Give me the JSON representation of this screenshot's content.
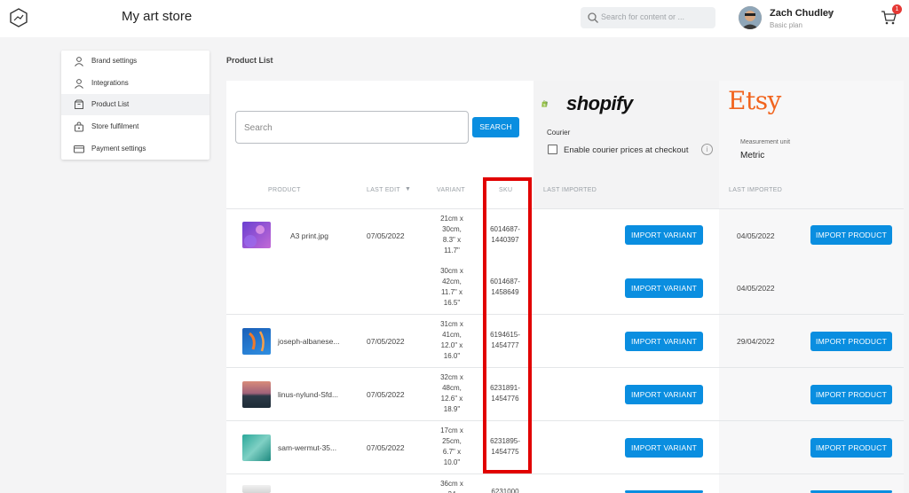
{
  "header": {
    "app_title": "My art store",
    "search_placeholder": "Search for content or ...",
    "user_name": "Zach Chudley",
    "user_plan": "Basic plan",
    "cart_count": "1"
  },
  "sidebar": {
    "items": [
      {
        "label": "Brand settings",
        "icon": "user-icon"
      },
      {
        "label": "Integrations",
        "icon": "user-icon"
      },
      {
        "label": "Product List",
        "icon": "box-icon",
        "active": true
      },
      {
        "label": "Store fulfilment",
        "icon": "store-icon"
      },
      {
        "label": "Payment settings",
        "icon": "card-icon"
      }
    ]
  },
  "page": {
    "section_title": "Product List",
    "search_placeholder": "Search",
    "search_button": "SEARCH"
  },
  "shopify": {
    "brand": "shopify",
    "courier_label": "Courier",
    "checkbox_label": "Enable courier prices at checkout",
    "info": "i"
  },
  "etsy": {
    "brand": "Etsy",
    "measurement_label": "Measurement unit",
    "measurement_value": "Metric"
  },
  "table": {
    "headers": {
      "product": "PRODUCT",
      "last_edit": "LAST EDIT",
      "variant": "VARIANT",
      "sku": "SKU",
      "shopify_last_imported": "LAST IMPORTED",
      "etsy_last_imported": "LAST IMPORTED"
    },
    "import_variant_label": "IMPORT VARIANT",
    "import_product_label": "IMPORT PRODUCT",
    "rows": [
      {
        "product": "A3 print.jpg",
        "last_edit": "07/05/2022",
        "variant": [
          "21cm x",
          "30cm,",
          "8.3\" x",
          "11.7\""
        ],
        "sku": [
          "6014687-",
          "1440397"
        ],
        "etsy_last_imported": "04/05/2022"
      },
      {
        "product": "",
        "last_edit": "",
        "variant": [
          "30cm x",
          "42cm,",
          "11.7\" x",
          "16.5\""
        ],
        "sku": [
          "6014687-",
          "1458649"
        ],
        "etsy_last_imported": "04/05/2022"
      },
      {
        "product": "joseph-albanese...",
        "last_edit": "07/05/2022",
        "variant": [
          "31cm x",
          "41cm,",
          "12.0\" x",
          "16.0\""
        ],
        "sku": [
          "6194615-",
          "1454777"
        ],
        "etsy_last_imported": "29/04/2022"
      },
      {
        "product": "linus-nylund-Sfd...",
        "last_edit": "07/05/2022",
        "variant": [
          "32cm x",
          "48cm,",
          "12.6\" x",
          "18.9\""
        ],
        "sku": [
          "6231891-",
          "1454776"
        ],
        "etsy_last_imported": ""
      },
      {
        "product": "sam-wermut-35...",
        "last_edit": "07/05/2022",
        "variant": [
          "17cm x",
          "25cm,",
          "6.7\" x",
          "10.0\""
        ],
        "sku": [
          "6231895-",
          "1454775"
        ],
        "etsy_last_imported": ""
      },
      {
        "product": "",
        "last_edit": "",
        "variant": [
          "36cm x",
          "24"
        ],
        "sku": [
          "6231000"
        ],
        "etsy_last_imported": ""
      }
    ]
  },
  "colors": {
    "accent": "#0a8ee0",
    "highlight": "#e10000",
    "etsy_orange": "#f1641e",
    "shopify_green": "#95bf47"
  }
}
